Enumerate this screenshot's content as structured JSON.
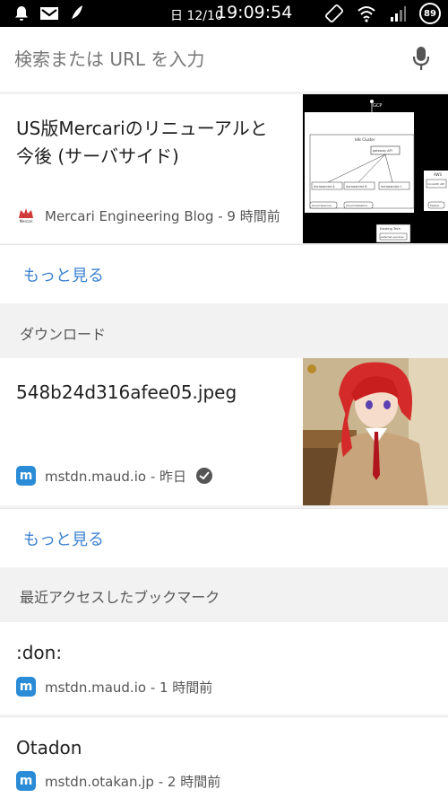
{
  "status_bar": {
    "date": "日 12/10",
    "time": "19:09:54",
    "battery": "89"
  },
  "search": {
    "placeholder": "検索または URL を入力"
  },
  "article": {
    "title": "US版Mercariのリニューアルと今後 (サーバサイド)",
    "source": "Mercari Engineering Blog - 9 時間前",
    "favicon_text": "Mercari",
    "diagram": {
      "top_label": "GCP",
      "cluster_label": "k8s Cluster",
      "gateway": "gateway API",
      "svc_a": "microservice A",
      "svc_b": "microservice B",
      "svc_c": "microservice C",
      "db_spanner": "Cloud Spanner",
      "db_datastore": "Cloud Datastore",
      "aws_label": "AWS",
      "monolith": "monolith API",
      "mysql": "MySQL",
      "existing": "Existing Tech",
      "external": "external services"
    }
  },
  "more_label_1": "もっと見る",
  "downloads": {
    "header": "ダウンロード",
    "title": "548b24d316afee05.jpeg",
    "source": "mstdn.maud.io - 昨日"
  },
  "more_label_2": "もっと見る",
  "bookmarks": {
    "header": "最近アクセスしたブックマーク",
    "items": [
      {
        "title": ":don:",
        "source": "mstdn.maud.io - 1 時間前"
      },
      {
        "title": "Otadon",
        "source": "mstdn.otakan.jp - 2 時間前"
      }
    ]
  }
}
